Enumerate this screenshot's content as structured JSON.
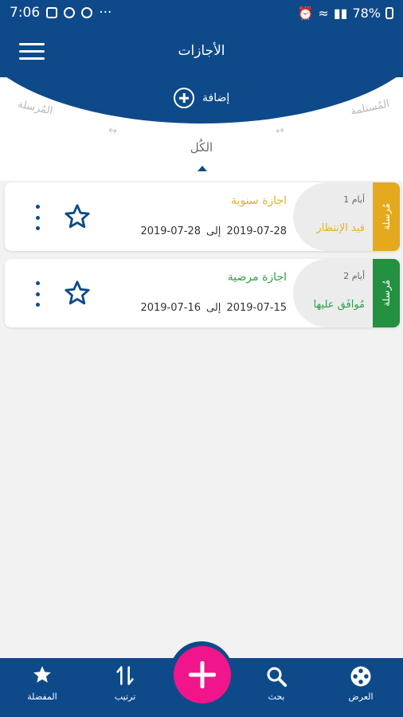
{
  "status_bar": {
    "time": "7:06",
    "battery": "78%"
  },
  "header": {
    "title": "الأجازات",
    "add_label": "إضافة"
  },
  "tabs": {
    "sent": "المُرسلة",
    "received": "المُستلمة",
    "all": "الكُل"
  },
  "leaves": [
    {
      "type": "اجازة سنوية",
      "days": "1 أيام",
      "state": "قيد الإنتظار",
      "status_tab": "مُرسلة",
      "from_date": "2019-07-28",
      "to_label": "إلى",
      "to_date": "2019-07-28",
      "accent_color": "#e4b12a",
      "tab_color": "#e4a91c"
    },
    {
      "type": "اجازة مرضية",
      "days": "2 أيام",
      "state": "مُوافَق عليها",
      "status_tab": "مُرسلة",
      "from_date": "2019-07-15",
      "to_label": "إلى",
      "to_date": "2019-07-16",
      "accent_color": "#2aa14a",
      "tab_color": "#23913f"
    }
  ],
  "bottom_nav": {
    "display": "العرض",
    "search": "بحث",
    "sort": "ترتيب",
    "favorites": "المفضلة"
  },
  "colors": {
    "primary": "#0e4a8a",
    "fab": "#f0158a"
  }
}
